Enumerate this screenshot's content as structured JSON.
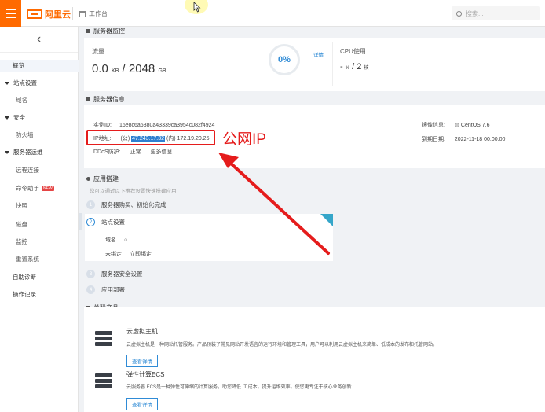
{
  "topbar": {
    "logo_text": "阿里云",
    "workbench": "工作台",
    "search_placeholder": "搜索..."
  },
  "sidebar": {
    "items": [
      {
        "label": "概览"
      },
      {
        "label": "站点设置"
      },
      {
        "label": "域名"
      },
      {
        "label": "安全"
      },
      {
        "label": "防火墙"
      },
      {
        "label": "服务器运维"
      },
      {
        "label": "远程连接"
      },
      {
        "label": "命令助手"
      },
      {
        "label": "快照"
      },
      {
        "label": "磁盘"
      },
      {
        "label": "监控"
      },
      {
        "label": "重置系统"
      },
      {
        "label": "自助诊断"
      },
      {
        "label": "操作记录"
      }
    ],
    "new_badge": "NEW"
  },
  "monitor": {
    "section_title": "服务器监控",
    "traffic_label": "流量",
    "traffic_used": "0.0",
    "traffic_used_unit": "KB",
    "traffic_sep": "/",
    "traffic_total": "2048",
    "traffic_total_unit": "GB",
    "gauge_value": "0%",
    "detail_link": "详情",
    "cpu_label": "CPU使用",
    "cpu_used": "-",
    "cpu_used_unit": "%",
    "cpu_sep": "/",
    "cpu_cores": "2",
    "cpu_cores_unit": "核"
  },
  "info": {
    "section_title": "服务器信息",
    "instance_id_label": "实例ID:",
    "instance_id": "16e8c6a6380a43339ca3954c082f4924",
    "ip_label": "IP地址:",
    "ip_public_prefix": "(公)",
    "ip_public": "47.243.17.32",
    "ip_private_prefix": "(内)",
    "ip_private": "172.19.20.25",
    "ddos_label": "DDoS防护:",
    "ddos_status": "正常",
    "ddos_more": "更多信息",
    "image_label": "镜像信息:",
    "image_value": "CentOS 7.6",
    "expire_label": "到期日期:",
    "expire_value": "2022-11-18 00:00:00"
  },
  "annotation": {
    "ip_note": "公网IP",
    "color": "#e51c1c"
  },
  "build": {
    "section_title": "应用搭建",
    "hint": "您可以通过以下推荐设置快速搭建应用",
    "steps": [
      {
        "number": "1",
        "label": "服务器购买、初始化完成"
      },
      {
        "number": "2",
        "label": "站点设置"
      },
      {
        "number": "3",
        "label": "服务器安全设置"
      },
      {
        "number": "4",
        "label": "应用部署"
      }
    ],
    "domain_label": "域名",
    "unbound_label": "未绑定",
    "bind_now": "立即绑定"
  },
  "products": {
    "section_title": "关联产品",
    "items": [
      {
        "title": "云虚拟主机",
        "desc": "云虚拟主机是一种网站托管服务。产品预装了常见网站开发语言的运行环境和管理工具，用户可以利用云虚拟主机来简单、低成本的发布和托管网站。",
        "button": "查看详情"
      },
      {
        "title": "弹性计算ECS",
        "desc": "云服务器 ECS是一种弹性可伸缩的计算服务，助您降低 IT 成本，提升运维效率，使您更专注于核心业务创新",
        "button": "查看详情"
      }
    ]
  },
  "colors": {
    "brand": "#ff6a00",
    "link": "#2f8bd6"
  }
}
